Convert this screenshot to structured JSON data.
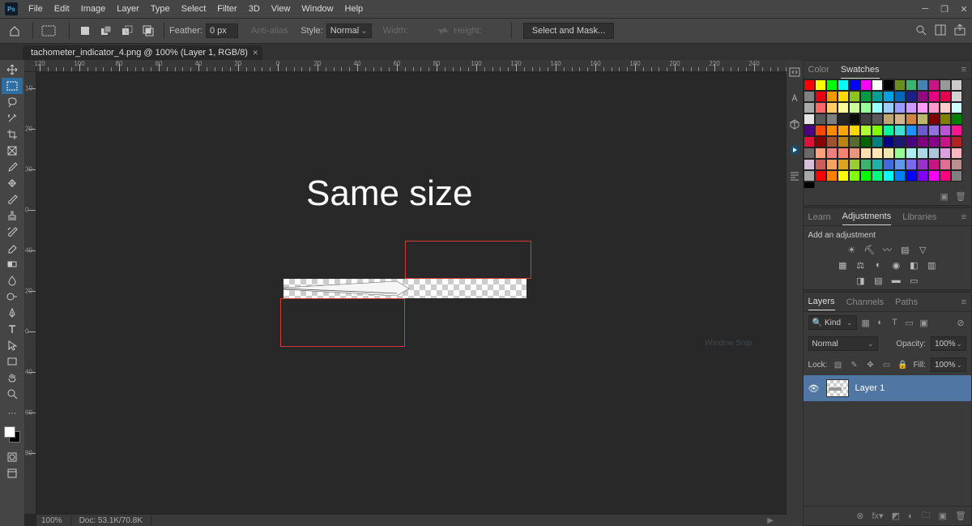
{
  "menubar": {
    "items": [
      "File",
      "Edit",
      "Image",
      "Layer",
      "Type",
      "Select",
      "Filter",
      "3D",
      "View",
      "Window",
      "Help"
    ]
  },
  "optionbar": {
    "feather_label": "Feather:",
    "feather_value": "0 px",
    "antialias_label": "Anti-alias",
    "style_label": "Style:",
    "style_value": "Normal",
    "width_label": "Width:",
    "height_label": "Height:",
    "select_mask": "Select and Mask..."
  },
  "document": {
    "tab_title": "tachometer_indicator_4.png @ 100% (Layer 1, RGB/8)",
    "zoom": "100%",
    "status_doc": "Doc: 53.1K/70.8K",
    "ruler_h": [
      "120",
      "100",
      "80",
      "60",
      "40",
      "20",
      "0",
      "20",
      "40",
      "60",
      "80",
      "100",
      "120",
      "140",
      "160",
      "180",
      "200",
      "220",
      "240"
    ],
    "ruler_v": [
      "1\n0",
      "2\n0",
      "3\n0",
      "0",
      "4\n0",
      "2\n0",
      "0",
      "4\n0",
      "6\n0",
      "8\n0"
    ]
  },
  "canvas": {
    "big_text": "Same size",
    "watermark": "Window Snip"
  },
  "right": {
    "color_tab": "Color",
    "swatches_tab": "Swatches",
    "learn_tab": "Learn",
    "adjustments_tab": "Adjustments",
    "libraries_tab": "Libraries",
    "add_adj": "Add an adjustment",
    "layers_tab": "Layers",
    "channels_tab": "Channels",
    "paths_tab": "Paths",
    "kind_label": "Kind",
    "blend_mode": "Normal",
    "opacity_label": "Opacity:",
    "opacity_value": "100%",
    "lock_label": "Lock:",
    "fill_label": "Fill:",
    "fill_value": "100%",
    "layer_name": "Layer 1"
  },
  "swatch_colors": [
    "#ff0000",
    "#ffff00",
    "#00ff00",
    "#00ffff",
    "#0000ff",
    "#ff00ff",
    "#ffffff",
    "#000000",
    "#6b8e23",
    "#3cb371",
    "#4682b4",
    "#c71585",
    "#999999",
    "#cccccc",
    "#808080",
    "#e60012",
    "#f39800",
    "#ffd900",
    "#8fc31f",
    "#009944",
    "#009e96",
    "#00a0e9",
    "#0068b7",
    "#1d2088",
    "#920783",
    "#e4007f",
    "#e5004f",
    "#d3d3d3",
    "#a9a9a9",
    "#ff6666",
    "#ffcc66",
    "#ffff99",
    "#ccff99",
    "#99ff99",
    "#99ffff",
    "#99ccff",
    "#9999ff",
    "#cc99ff",
    "#ff99ff",
    "#ff99cc",
    "#ffcccc",
    "#ccffff",
    "#e6e6e6",
    "#595959",
    "#7f7f7f",
    "#262626",
    "#0d0d0d",
    "#404040",
    "#595959",
    "#bfa46f",
    "#d2b48c",
    "#cd853f",
    "#bdb76b",
    "#800000",
    "#808000",
    "#008000",
    "#4b0082",
    "#ff4500",
    "#ff8c00",
    "#ffa500",
    "#ffd700",
    "#adff2f",
    "#7fff00",
    "#00fa9a",
    "#40e0d0",
    "#1e90ff",
    "#6a5acd",
    "#9370db",
    "#ba55d3",
    "#ff1493",
    "#dc143c",
    "#8b0000",
    "#a0522d",
    "#b8860b",
    "#556b2f",
    "#006400",
    "#008080",
    "#00008b",
    "#191970",
    "#4b0082",
    "#800080",
    "#8b008b",
    "#c71585",
    "#b22222",
    "#696969",
    "#ffa07a",
    "#f08080",
    "#fa8072",
    "#e9967a",
    "#ffdead",
    "#ffe4b5",
    "#eee8aa",
    "#98fb98",
    "#afeeee",
    "#add8e6",
    "#b0c4de",
    "#dda0dd",
    "#ffb6c1",
    "#d8bfd8",
    "#cd5c5c",
    "#f4a460",
    "#daa520",
    "#9acd32",
    "#3cb371",
    "#20b2aa",
    "#4169e1",
    "#6495ed",
    "#7b68ee",
    "#9932cc",
    "#c71585",
    "#db7093",
    "#bc8f8f",
    "#a9a9a9",
    "#ff0000",
    "#ff7f00",
    "#ffff00",
    "#7fff00",
    "#00ff00",
    "#00ff7f",
    "#00ffff",
    "#007fff",
    "#0000ff",
    "#7f00ff",
    "#ff00ff",
    "#ff007f",
    "#808080",
    "#000000"
  ]
}
